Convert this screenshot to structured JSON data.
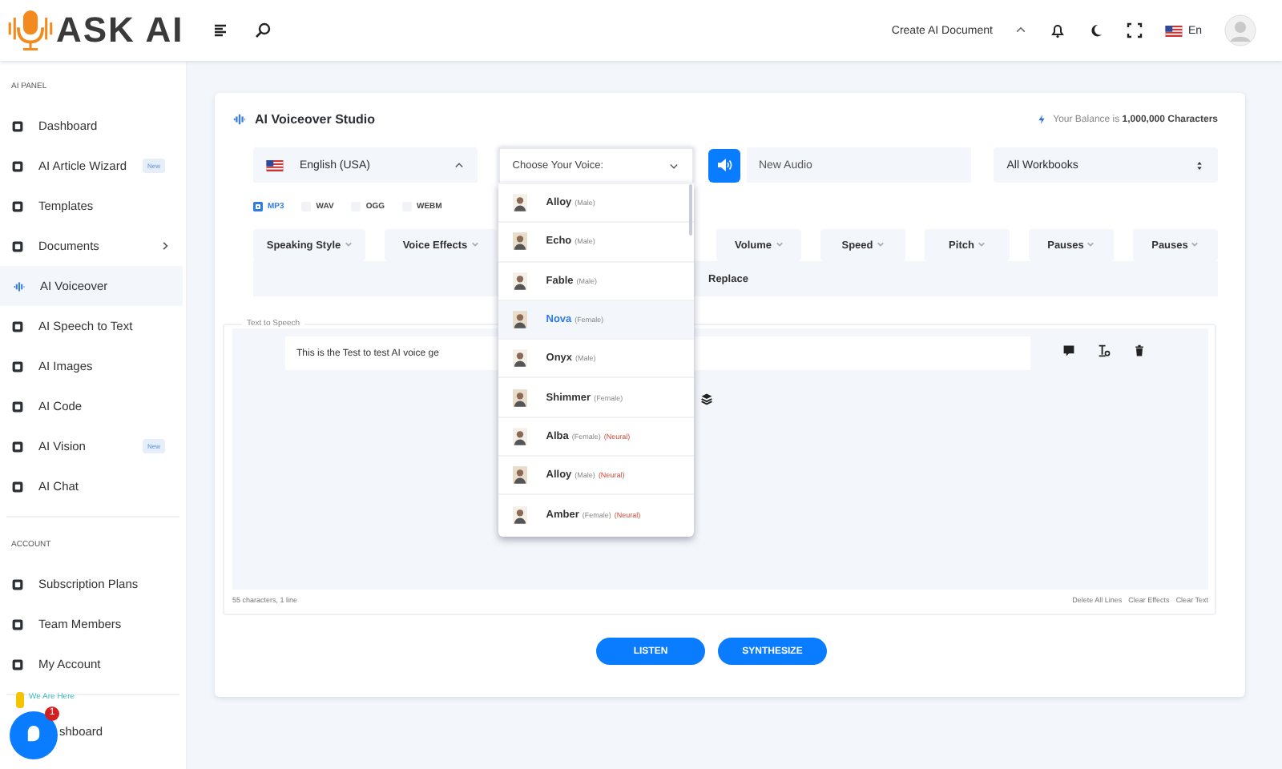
{
  "header": {
    "logo": "ASK AI",
    "create_link": "Create AI Document",
    "language": "En"
  },
  "sidebar": {
    "sections": [
      {
        "title": "AI PANEL",
        "items": [
          {
            "label": "Dashboard",
            "selected": false
          },
          {
            "label": "AI Article Wizard",
            "badge": "New",
            "selected": false
          },
          {
            "label": "Templates",
            "selected": false
          },
          {
            "label": "Documents",
            "has_submenu": true,
            "selected": false
          },
          {
            "label": "AI Voiceover",
            "selected": true
          },
          {
            "label": "AI Speech to Text",
            "selected": false
          },
          {
            "label": "AI Images",
            "selected": false
          },
          {
            "label": "AI Code",
            "selected": false
          },
          {
            "label": "AI Vision",
            "badge": "New",
            "selected": false
          },
          {
            "label": "AI Chat",
            "selected": false
          }
        ]
      },
      {
        "title": "ACCOUNT",
        "items": [
          {
            "label": "Subscription Plans",
            "selected": false
          },
          {
            "label": "Team Members",
            "selected": false
          },
          {
            "label": "My Account",
            "selected": false
          }
        ]
      }
    ],
    "partial_item": "shboard"
  },
  "chat_widget": {
    "unread": "1",
    "caption": "We Are Here"
  },
  "studio": {
    "title": "AI Voiceover Studio",
    "balance": "Your Balance is **1,000,000 Characters**",
    "language_select": "English (USA)",
    "voice_select": {
      "label": "Choose Your Voice:",
      "open": true,
      "options": [
        {
          "name": "Alloy",
          "gender": "(Male)",
          "selected": false
        },
        {
          "name": "Echo",
          "gender": "(Male)",
          "selected": false
        },
        {
          "name": "Fable",
          "gender": "(Male)",
          "selected": false
        },
        {
          "name": "Nova",
          "gender": "(Female)",
          "selected": true
        },
        {
          "name": "Onyx",
          "gender": "(Male)",
          "selected": false
        },
        {
          "name": "Shimmer",
          "gender": "(Female)",
          "selected": false
        },
        {
          "name": "Alba",
          "gender": "(Female)",
          "tag": "(Neural)",
          "selected": false
        },
        {
          "name": "Alloy",
          "gender": "(Male)",
          "tag": "(Neural)",
          "selected": false
        },
        {
          "name": "Amber",
          "gender": "(Female)",
          "tag": "(Neural)",
          "selected": false
        }
      ]
    },
    "audio_name": {
      "placeholder": "New Audio"
    },
    "workbook_select": "All Workbooks",
    "formats": [
      {
        "label": "MP3",
        "selected": true
      },
      {
        "label": "WAV",
        "selected": false
      },
      {
        "label": "OGG",
        "selected": false
      },
      {
        "label": "WEBM",
        "selected": false
      }
    ],
    "effects_left": [
      "Speaking Style",
      "Voice Effects"
    ],
    "effects_right": [
      "Volume",
      "Speed",
      "Pitch",
      "Pauses",
      "Pauses"
    ],
    "replace": "Replace",
    "text_to_speech": {
      "legend": "Text to Speech",
      "line": "This is the Test to test AI voice ge",
      "status": "55 characters, 1 line",
      "actions": [
        "Delete All Lines",
        "Clear Effects",
        "Clear Text"
      ]
    },
    "buttons": [
      "LISTEN",
      "SYNTHESIZE"
    ]
  }
}
